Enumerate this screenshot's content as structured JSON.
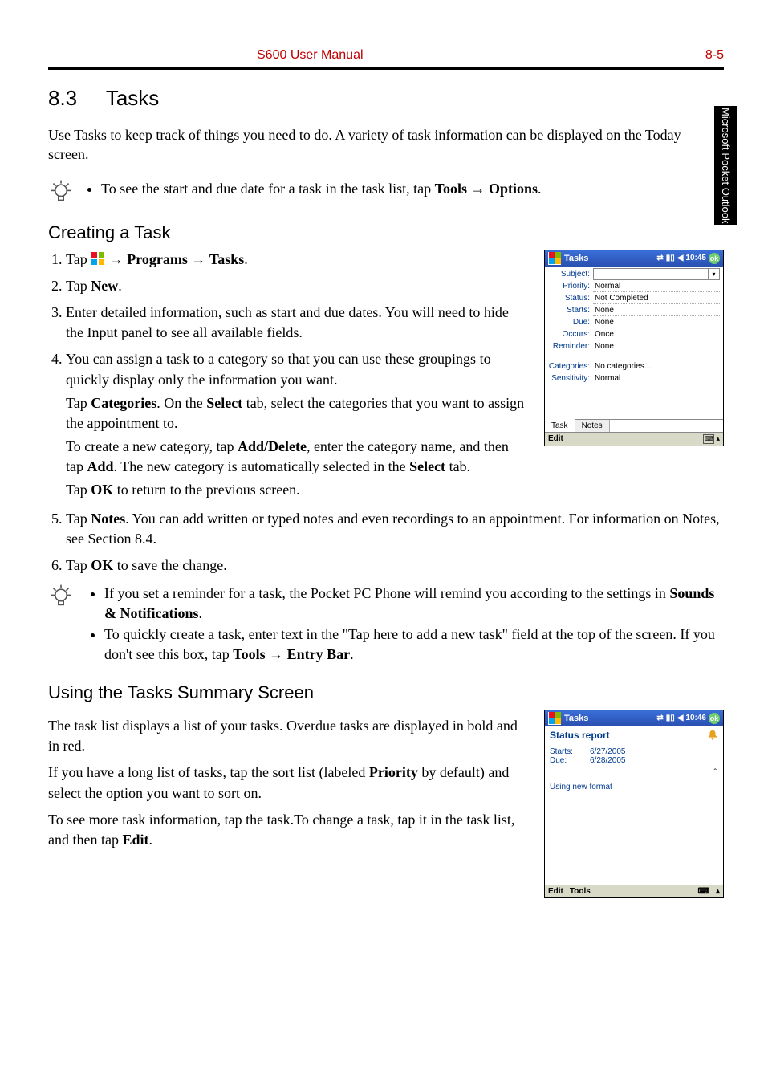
{
  "header": {
    "center": "S600 User Manual",
    "right": "8-5"
  },
  "side_tab": "Microsoft Pocket Outlook",
  "section": {
    "number": "8.3",
    "title": "Tasks",
    "intro": "Use Tasks to keep track of things you need to do. A variety of task information can be displayed on the Today screen."
  },
  "tip1": {
    "text_pre": "To see the start and due date for a task in the task list, tap ",
    "bold1": "Tools",
    "arrow": " → ",
    "bold2": "Options",
    "text_post": "."
  },
  "subheading1": "Creating a Task",
  "steps": [
    {
      "pre": "Tap ",
      "b1": "",
      "mid1": " → ",
      "b2": "Programs",
      "mid2": " → ",
      "b3": "Tasks",
      "post": "."
    },
    {
      "pre": "Tap ",
      "b1": "New",
      "post": "."
    },
    {
      "text": "Enter detailed information, such as start and due dates. You will need to hide the Input panel to see all available fields."
    },
    {
      "text": "You can assign a task to a category so that you can use these groupings to quickly display only the information you want.",
      "p1_pre": "Tap ",
      "p1_b1": "Categories",
      "p1_mid1": ". On the ",
      "p1_b2": "Select",
      "p1_post": " tab, select the categories that you want to assign the appointment to.",
      "p2_pre": "To create a new category, tap ",
      "p2_b1": "Add/Delete",
      "p2_mid1": ", enter the category name, and then tap ",
      "p2_b2": "Add",
      "p2_mid2": ". The new category is automatically selected in the ",
      "p2_b3": "Select",
      "p2_post": " tab.",
      "p3_pre": "Tap ",
      "p3_b1": "OK",
      "p3_post": " to return to the previous screen."
    },
    {
      "pre": "Tap ",
      "b1": "Notes",
      "post": ". You can add written or typed notes and even recordings to an appointment. For information on Notes, see Section 8.4."
    },
    {
      "pre": "Tap ",
      "b1": "OK",
      "post": " to save the change."
    }
  ],
  "tip2": {
    "b1_pre": "If you set a reminder for a task, the Pocket PC Phone will remind you according to the settings in ",
    "b1_bold": "Sounds & Notifications",
    "b1_post": ".",
    "b2_pre": "To quickly create a task, enter text in the \"Tap here to add a new task\" field at the top of the screen. If you don't see this box, tap ",
    "b2_bold1": "Tools",
    "b2_arrow": " → ",
    "b2_bold2": "Entry Bar",
    "b2_post": "."
  },
  "subheading2": "Using the Tasks Summary Screen",
  "summary": {
    "p1": "The task list displays a list of your tasks. Overdue tasks are displayed in bold and in red.",
    "p2_pre": "If you have a long list of tasks, tap the sort list (labeled ",
    "p2_b": "Priority",
    "p2_post": " by default) and select the option you want to sort on.",
    "p3_pre": "To see more task information, tap the task.To change a task, tap it in the task list, and then tap ",
    "p3_b": "Edit",
    "p3_post": "."
  },
  "ppc1": {
    "title": "Tasks",
    "time": "10:45",
    "ok": "ok",
    "tabs": {
      "task": "Task",
      "notes": "Notes"
    },
    "menu": "Edit",
    "rows": [
      {
        "l": "Subject:",
        "v": ""
      },
      {
        "l": "Priority:",
        "v": "Normal"
      },
      {
        "l": "Status:",
        "v": "Not Completed"
      },
      {
        "l": "Starts:",
        "v": "None"
      },
      {
        "l": "Due:",
        "v": "None"
      },
      {
        "l": "Occurs:",
        "v": "Once"
      },
      {
        "l": "Reminder:",
        "v": "None"
      }
    ],
    "rows2": [
      {
        "l": "Categories:",
        "v": "No categories..."
      },
      {
        "l": "Sensitivity:",
        "v": "Normal"
      }
    ]
  },
  "ppc2": {
    "title": "Tasks",
    "time": "10:46",
    "ok": "ok",
    "heading": "Status report",
    "starts_l": "Starts:",
    "starts_v": "6/27/2005",
    "due_l": "Due:",
    "due_v": "6/28/2005",
    "note": "Using new format",
    "menu_edit": "Edit",
    "menu_tools": "Tools"
  }
}
